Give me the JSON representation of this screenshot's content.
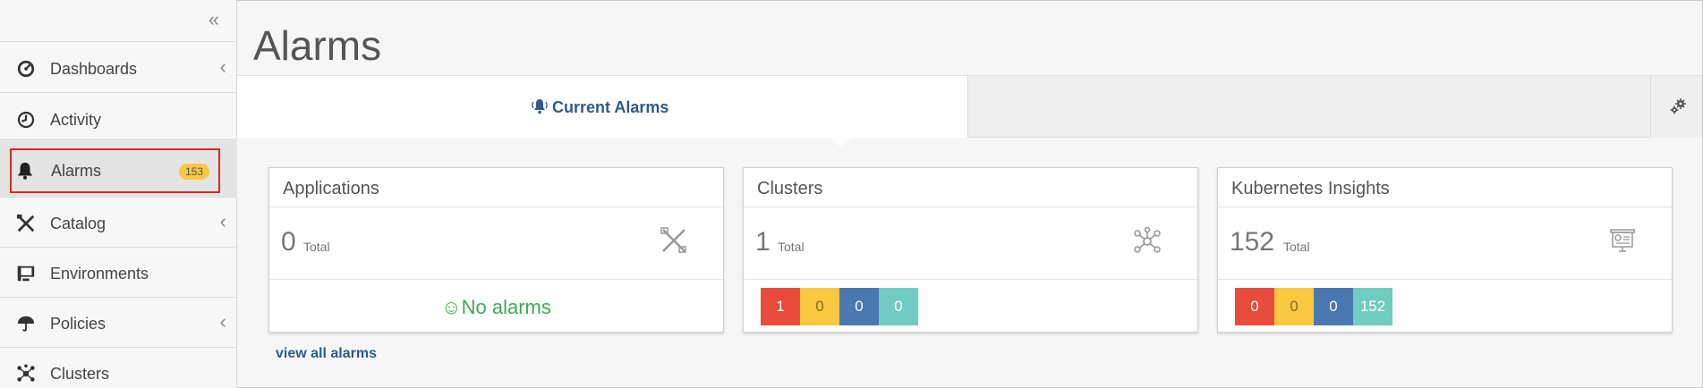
{
  "sidebar": {
    "collapse_icon": "double-chevron-left-icon",
    "items": [
      {
        "label": "Dashboards",
        "icon": "gauge-icon",
        "has_submenu": true
      },
      {
        "label": "Activity",
        "icon": "clock-icon",
        "has_submenu": false
      },
      {
        "label": "Alarms",
        "icon": "bell-icon",
        "badge": "153",
        "active": true
      },
      {
        "label": "Catalog",
        "icon": "tools-icon",
        "has_submenu": true
      },
      {
        "label": "Environments",
        "icon": "monitor-icon",
        "has_submenu": false
      },
      {
        "label": "Policies",
        "icon": "umbrella-icon",
        "has_submenu": true
      },
      {
        "label": "Clusters",
        "icon": "cluster-icon",
        "has_submenu": false
      }
    ]
  },
  "page": {
    "title": "Alarms",
    "tab_label": "Current Alarms",
    "settings_icon": "gears-icon",
    "view_all": "view all alarms"
  },
  "cards": [
    {
      "title": "Applications",
      "count": "0",
      "total_label": "Total",
      "icon": "tools-icon",
      "no_alarms": "No alarms"
    },
    {
      "title": "Clusters",
      "count": "1",
      "total_label": "Total",
      "icon": "cluster-icon",
      "severities": [
        "1",
        "0",
        "0",
        "0"
      ]
    },
    {
      "title": "Kubernetes Insights",
      "count": "152",
      "total_label": "Total",
      "icon": "presentation-icon",
      "severities": [
        "0",
        "0",
        "0",
        "152"
      ]
    }
  ],
  "colors": {
    "critical": "#e84b3c",
    "major": "#f8c840",
    "minor": "#4a78b0",
    "info": "#70cbc0",
    "accent": "#2f5a8c",
    "highlight": "#d4282e"
  }
}
